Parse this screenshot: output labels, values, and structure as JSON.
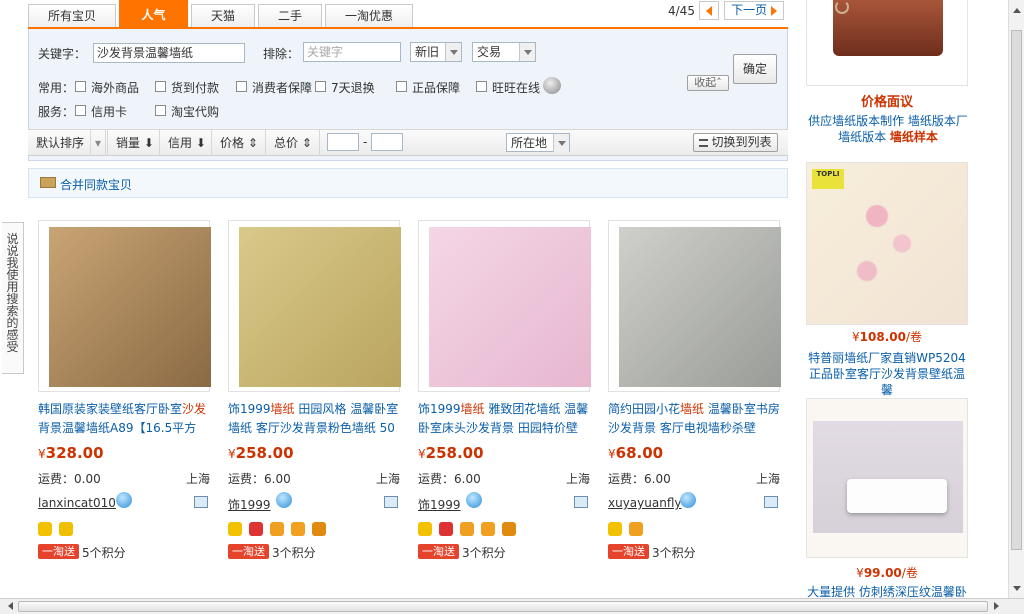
{
  "tabs": [
    "所有宝贝",
    "人气",
    "天猫",
    "二手",
    "一淘优惠"
  ],
  "pager": {
    "page": "4/45",
    "next": "下一页"
  },
  "filter": {
    "keyword_label": "关键字：",
    "keyword_value": "沙发背景温馨墙纸",
    "exclude_label": "排除：",
    "exclude_placeholder": "关键字",
    "select1": "新旧",
    "select2": "交易",
    "confirm": "确定",
    "collapse": "收起",
    "common_label": "常用：",
    "service_label": "服务：",
    "options_row1": [
      "海外商品",
      "货到付款",
      "消费者保障",
      "7天退换",
      "正品保障",
      "旺旺在线"
    ],
    "options_row2": [
      "信用卡",
      "淘宝代购"
    ]
  },
  "sort": {
    "default": "默认排序",
    "sales": "销量",
    "credit": "信用",
    "price": "价格",
    "total": "总价",
    "dash": "-",
    "location": "所在地",
    "switch": "切换到列表"
  },
  "merge_label": "合并同款宝贝",
  "side_feedback": "说说我使用搜索的感受",
  "products": [
    {
      "title_a": "韩国原装家装壁纸客厅卧室",
      "title_b": "沙发",
      "title_c": "背景温馨墙纸",
      "title_d": "A89【16.5平方",
      "price": "328.00",
      "ship": "运费：0.00",
      "loc": "上海",
      "seller": "lanxincat010",
      "points": "5个积分"
    },
    {
      "title_a": "饰1999",
      "title_b": "墙纸",
      "title_c": " 田园风格 ",
      "title_d": "温馨卧室墙纸 客厅沙发背景粉色墙纸 50",
      "price": "258.00",
      "ship": "运费：6.00",
      "loc": "上海",
      "seller": "饰1999",
      "points": "3个积分"
    },
    {
      "title_a": "饰1999",
      "title_b": "墙纸",
      "title_c": " 雅致团花",
      "title_d": "墙纸 温馨卧室床头沙发背景 田园特价壁",
      "price": "258.00",
      "ship": "运费：6.00",
      "loc": "上海",
      "seller": "饰1999",
      "points": "3个积分"
    },
    {
      "title_a": "简约田园小花",
      "title_b": "墙纸",
      "title_c": " 温馨",
      "title_d": "卧室书房沙发背景 客厅电视墙秒杀壁",
      "price": "68.00",
      "ship": "运费：6.00",
      "loc": "上海",
      "seller": "xuyayuanfly",
      "points": "3个积分"
    }
  ],
  "yitao": "一淘送",
  "currency": "¥",
  "right": {
    "ad1_title": "价格面议",
    "ad1_desc_a": "供应墙纸版本制作 墙纸版本厂",
    "ad1_desc_b": "墙纸版本",
    "ad1_desc_c": "墙纸样本",
    "ad2_brand": "TOPLI",
    "ad2_price": "108.00",
    "ad2_unit": "/卷",
    "ad2_desc": "特普丽墙纸厂家直销WP5204正品卧室客厅沙发背景壁纸温馨",
    "ad3_price": "99.00",
    "ad3_unit": "/卷",
    "ad3_desc": "大量提供 仿刺绣深压纹温馨卧"
  },
  "colors": {
    "accent": "#ff7300",
    "price": "#cc3300",
    "link": "#0a5ea8"
  }
}
